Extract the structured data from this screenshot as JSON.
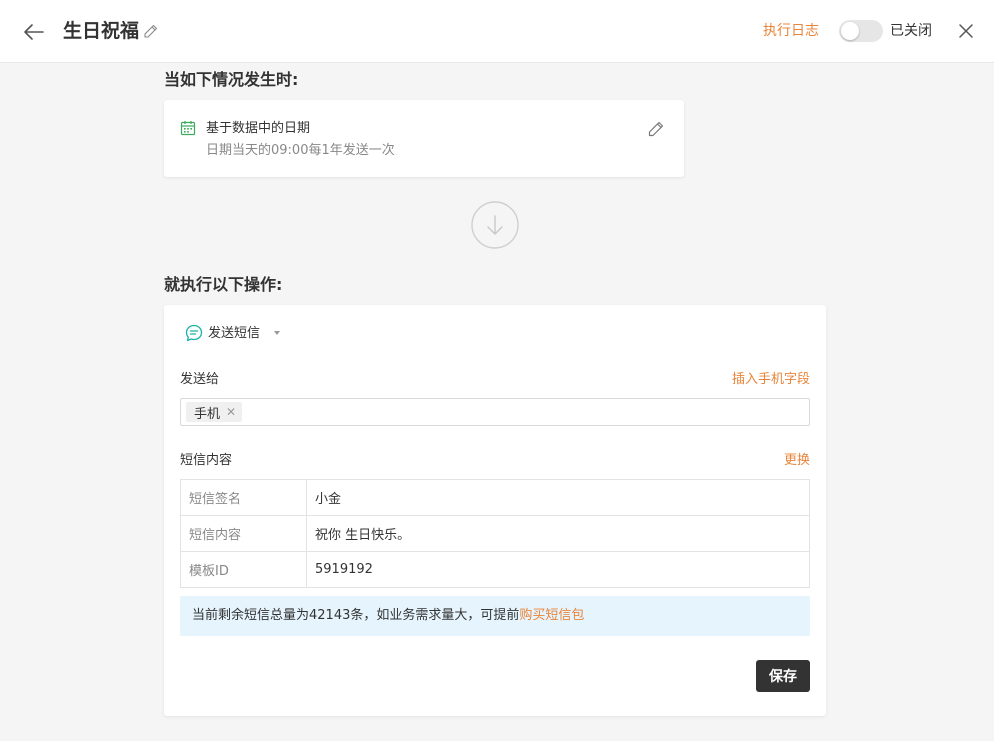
{
  "header": {
    "title": "生日祝福",
    "log_label": "执行日志",
    "toggle_label": "已关闭",
    "toggle_on": false
  },
  "trigger": {
    "heading": "当如下情况发生时:",
    "title": "基于数据中的日期",
    "description": "日期当天的09:00每1年发送一次"
  },
  "action": {
    "heading": "就执行以下操作:",
    "type_label": "发送短信",
    "send_to_label": "发送给",
    "insert_field_label": "插入手机字段",
    "recipients": [
      "手机"
    ],
    "content_label": "短信内容",
    "change_label": "更换",
    "table": [
      {
        "key": "短信签名",
        "value": "小金"
      },
      {
        "key": "短信内容",
        "value": "祝你 生日快乐。"
      },
      {
        "key": "模板ID",
        "value": "5919192"
      }
    ],
    "notice_text": "当前剩余短信总量为42143条，如业务需求量大，可提前",
    "notice_link": "购买短信包",
    "save_label": "保存"
  },
  "colors": {
    "accent": "#e8853a",
    "calendar_icon": "#3aaa5c",
    "sms_icon": "#1bb3a6",
    "notice_bg": "#e6f4fd",
    "save_button": "#333333"
  },
  "icons": {
    "back": "arrow-left-icon",
    "title_edit": "pencil-icon",
    "close": "close-icon",
    "calendar": "calendar-icon",
    "trigger_edit": "pencil-icon",
    "flow": "arrow-down-circle-icon",
    "sms": "chat-bubble-icon",
    "tag_remove": "close-icon"
  }
}
